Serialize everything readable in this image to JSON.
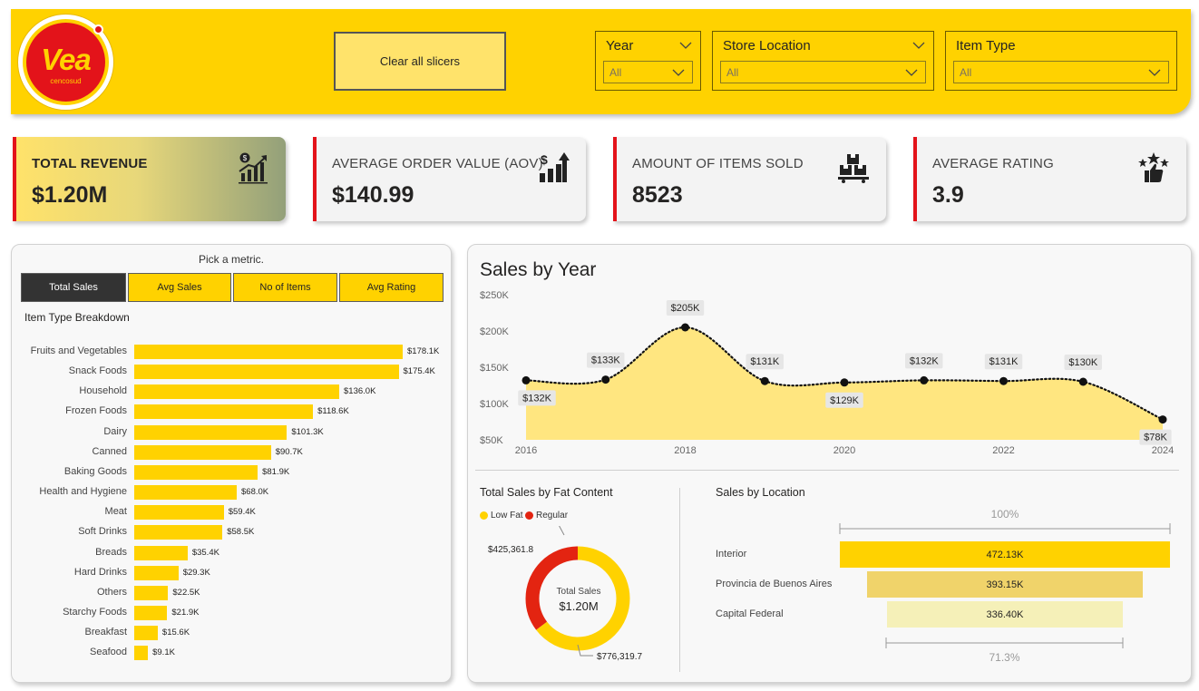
{
  "header": {
    "logo_text": "Vea",
    "logo_sub": "cencosud",
    "clear_button": "Clear all slicers",
    "slicers": [
      {
        "title": "Year",
        "value": "All"
      },
      {
        "title": "Store Location",
        "value": "All"
      },
      {
        "title": "Item Type",
        "value": "All"
      }
    ]
  },
  "kpis": [
    {
      "title": "TOTAL REVENUE",
      "value": "$1.20M",
      "icon": "revenue-chart-icon"
    },
    {
      "title": "AVERAGE ORDER VALUE (AOV)",
      "value": "$140.99",
      "icon": "dollar-growth-icon"
    },
    {
      "title": "AMOUNT OF ITEMS SOLD",
      "value": "8523",
      "icon": "boxes-pallet-icon"
    },
    {
      "title": "AVERAGE RATING",
      "value": "3.9",
      "icon": "stars-thumbs-up-icon"
    }
  ],
  "metric_picker": {
    "title": "Pick a metric.",
    "buttons": [
      "Total Sales",
      "Avg Sales",
      "No of Items",
      "Avg Rating"
    ],
    "active": "Total Sales"
  },
  "breakdown": {
    "title": "Item Type Breakdown"
  },
  "sales_by_year": {
    "title": "Sales by Year"
  },
  "fat_content": {
    "title": "Total Sales by Fat Content",
    "legend": [
      "Low Fat",
      "Regular"
    ],
    "center_label": "Total Sales",
    "center_value": "$1.20M",
    "label_regular": "$425,361.8",
    "label_lowfat": "$776,319.7"
  },
  "location": {
    "title": "Sales by Location",
    "top_pct": "100%",
    "bottom_pct": "71.3%"
  },
  "colors": {
    "brand_yellow": "#FFD200",
    "brand_red": "#E3131A",
    "area_fill": "#FFE680"
  },
  "chart_data": [
    {
      "type": "bar",
      "orientation": "horizontal",
      "title": "Item Type Breakdown",
      "categories": [
        "Fruits and Vegetables",
        "Snack Foods",
        "Household",
        "Frozen Foods",
        "Dairy",
        "Canned",
        "Baking Goods",
        "Health and Hygiene",
        "Meat",
        "Soft Drinks",
        "Breads",
        "Hard Drinks",
        "Others",
        "Starchy Foods",
        "Breakfast",
        "Seafood"
      ],
      "values": [
        178.1,
        175.4,
        136.0,
        118.6,
        101.3,
        90.7,
        81.9,
        68.0,
        59.4,
        58.5,
        35.4,
        29.3,
        22.5,
        21.9,
        15.6,
        9.1
      ],
      "labels": [
        "$178.1K",
        "$175.4K",
        "$136.0K",
        "$118.6K",
        "$101.3K",
        "$90.7K",
        "$81.9K",
        "$68.0K",
        "$59.4K",
        "$58.5K",
        "$35.4K",
        "$29.3K",
        "$22.5K",
        "$21.9K",
        "$15.6K",
        "$9.1K"
      ]
    },
    {
      "type": "area",
      "title": "Sales by Year",
      "x": [
        2016,
        2017,
        2018,
        2019,
        2020,
        2021,
        2022,
        2023,
        2024
      ],
      "values": [
        132,
        133,
        205,
        131,
        129,
        132,
        131,
        130,
        78
      ],
      "labels": [
        "$132K",
        "$133K",
        "$205K",
        "$131K",
        "$129K",
        "$132K",
        "$131K",
        "$130K",
        "$78K"
      ],
      "xticks": [
        "2016",
        "2018",
        "2020",
        "2022",
        "2024"
      ],
      "yticks": [
        "$50K",
        "$100K",
        "$150K",
        "$200K",
        "$250K"
      ],
      "ylim": [
        50,
        250
      ]
    },
    {
      "type": "pie",
      "title": "Total Sales by Fat Content",
      "categories": [
        "Low Fat",
        "Regular"
      ],
      "values": [
        776319.7,
        425361.8
      ]
    },
    {
      "type": "bar",
      "subtype": "funnel",
      "title": "Sales by Location",
      "categories": [
        "Interior",
        "Provincia de Buenos Aires",
        "Capital Federal"
      ],
      "values": [
        472.13,
        393.15,
        336.4
      ],
      "labels": [
        "472.13K",
        "393.15K",
        "336.40K"
      ]
    }
  ]
}
